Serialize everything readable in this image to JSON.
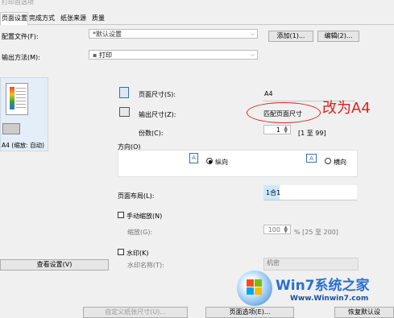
{
  "window": {
    "title": "打印首选项"
  },
  "tabs": [
    "页面设置",
    "完成方式",
    "纸张来源",
    "质量"
  ],
  "profile": {
    "label": "配置文件(F):",
    "value": "*默认设置",
    "add": "添加(1)...",
    "edit": "编辑(2)..."
  },
  "output_method": {
    "label": "输出方法(M):",
    "value": "打印"
  },
  "preview": {
    "caption": "A4 (缩放: 自动)",
    "view_button": "查看设置(V)"
  },
  "paper_size": {
    "label": "页面尺寸(S):",
    "value": "A4"
  },
  "output_size": {
    "label": "输出尺寸(Z):",
    "value": "匹配页面尺寸",
    "annotation": "改为A4"
  },
  "copies": {
    "label": "份数(C):",
    "value": "1",
    "range": "[1 至 99]"
  },
  "orientation": {
    "group": "方向(O)",
    "portrait": "纵向",
    "landscape": "横向"
  },
  "layout": {
    "label": "页面布局(L):",
    "value": "1合1"
  },
  "manual_zoom": {
    "label": "手动缩放(N)",
    "zoom_label": "缩放(G):",
    "value": "100",
    "range": "% [25 至 200]"
  },
  "watermark": {
    "label": "水印(K)",
    "name_label": "水印名称(T):",
    "value": "机密"
  },
  "bottom": {
    "custom_paper": "自定义纸张尺寸(U)...",
    "page_options": "页面选项(E)...",
    "restore": "恢复默认设"
  },
  "site_logo": {
    "brand": "Win7系统之家",
    "url": "Www.Winwin7.com"
  },
  "colors": {
    "annotation": "#e02020",
    "accent": "#cce8ff"
  }
}
